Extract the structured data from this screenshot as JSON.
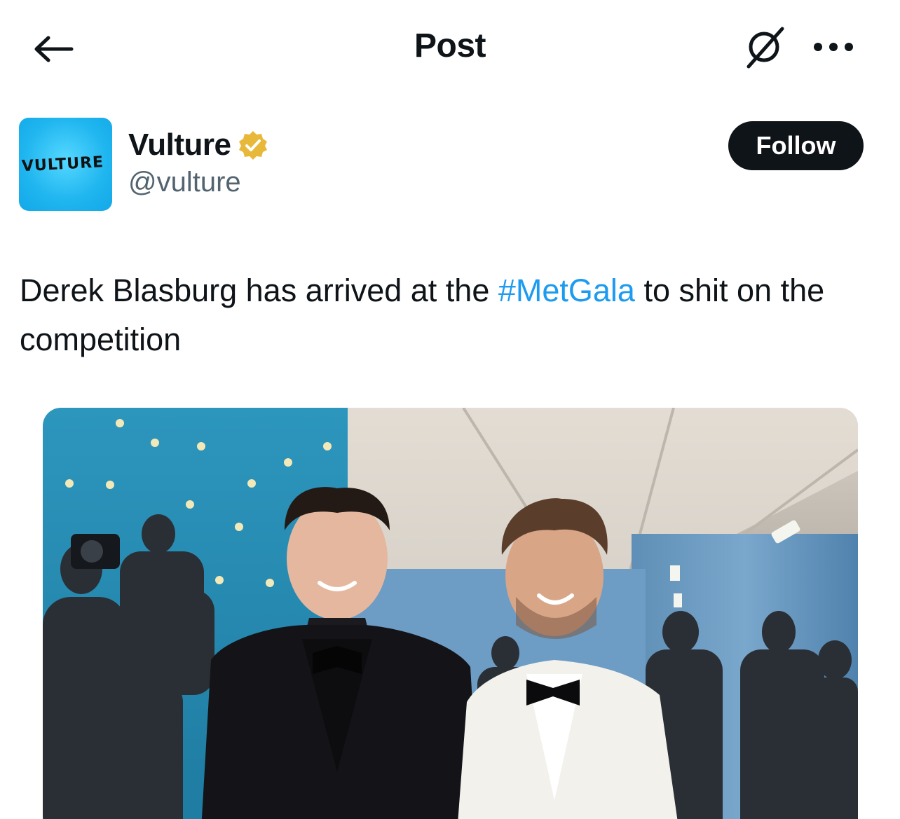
{
  "header": {
    "title": "Post",
    "back_icon": "arrow-left-icon",
    "grok_icon": "grok-icon",
    "more_icon": "more-horizontal-icon"
  },
  "author": {
    "name": "Vulture",
    "handle": "@vulture",
    "avatar_text": "VULTURE",
    "avatar_color": "#1fb5ef",
    "verified_icon": "verified-badge-icon",
    "verified_color": "#e8b83a"
  },
  "follow_button": {
    "label": "Follow"
  },
  "post": {
    "text_before": "Derek Blasburg has arrived at the ",
    "hashtag": "#MetGala",
    "text_after": " to shit on the competition",
    "hashtag_color": "#1d9bf0"
  },
  "media": {
    "kind": "photo"
  }
}
